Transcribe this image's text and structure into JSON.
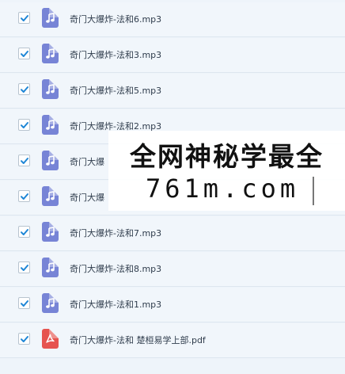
{
  "files": [
    {
      "name": "奇门大爆炸-法和6.mp3",
      "type": "mp3",
      "checked": true
    },
    {
      "name": "奇门大爆炸-法和3.mp3",
      "type": "mp3",
      "checked": true
    },
    {
      "name": "奇门大爆炸-法和5.mp3",
      "type": "mp3",
      "checked": true
    },
    {
      "name": "奇门大爆炸-法和2.mp3",
      "type": "mp3",
      "checked": true
    },
    {
      "name": "奇门大爆",
      "type": "mp3",
      "checked": true
    },
    {
      "name": "奇门大爆",
      "type": "mp3",
      "checked": true
    },
    {
      "name": "奇门大爆炸-法和7.mp3",
      "type": "mp3",
      "checked": true
    },
    {
      "name": "奇门大爆炸-法和8.mp3",
      "type": "mp3",
      "checked": true
    },
    {
      "name": "奇门大爆炸-法和1.mp3",
      "type": "mp3",
      "checked": true
    },
    {
      "name": "奇门大爆炸-法和 楚桓易学上部.pdf",
      "type": "pdf",
      "checked": true
    }
  ],
  "watermark": {
    "line1": "全网神秘学最全",
    "line2": "761m.com"
  },
  "colors": {
    "checkmark": "#1e86d6",
    "mp3_icon": "#7784d6",
    "pdf_icon": "#e6544f"
  },
  "icons": {
    "mp3": "music-note-icon",
    "pdf": "pdf-acrobat-icon",
    "checkbox": "checkmark-icon"
  }
}
